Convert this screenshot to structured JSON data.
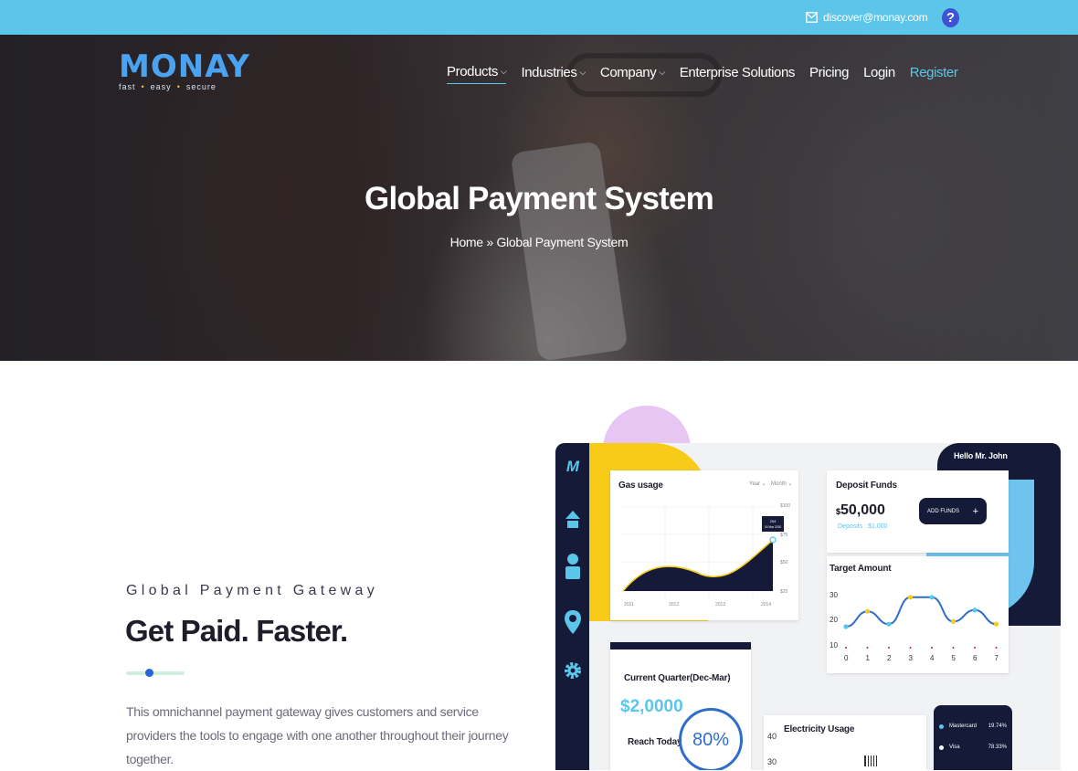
{
  "topbar": {
    "email": "discover@monay.com",
    "help_icon": "help-icon"
  },
  "logo": {
    "name": "Monay",
    "tagline": [
      "fast",
      "easy",
      "secure"
    ]
  },
  "nav": {
    "items": [
      {
        "label": "Products",
        "dropdown": true
      },
      {
        "label": "Industries",
        "dropdown": true
      },
      {
        "label": "Company",
        "dropdown": true
      },
      {
        "label": "Enterprise Solutions"
      },
      {
        "label": "Pricing"
      },
      {
        "label": "Login"
      },
      {
        "label": "Register"
      }
    ]
  },
  "hero": {
    "title": "Global Payment System",
    "breadcrumb_home": "Home",
    "breadcrumb_sep": " » ",
    "breadcrumb_current": "Global Payment System"
  },
  "section": {
    "eyebrow": "Global Payment Gateway",
    "title": "Get Paid. Faster.",
    "description": "This omnichannel payment gateway gives customers and service providers the tools to engage with one another throughout their journey together."
  },
  "dashboard": {
    "greeting": "Hello Mr. John",
    "gas": {
      "title": "Gas usage",
      "toggle_a": "Year",
      "toggle_b": "Month",
      "tooltip_a": "254",
      "tooltip_b": "16 Mar 2020",
      "y_ticks": [
        "$100",
        "$75",
        "$50",
        "$25"
      ],
      "x_ticks": [
        "2011",
        "2012",
        "2013",
        "2014"
      ]
    },
    "deposit": {
      "title": "Deposit Funds",
      "currency": "$",
      "amount": "50,000",
      "deposits": "Deposits : $1,000",
      "button": "ADD FUNDS",
      "button_icon": "+"
    },
    "target": {
      "title": "Target Amount",
      "y_ticks": [
        "30",
        "20",
        "10"
      ],
      "x_ticks": [
        "0",
        "1",
        "2",
        "3",
        "4",
        "5",
        "6",
        "7"
      ]
    },
    "quarter": {
      "title": "Current Quarter(Dec-Mar)",
      "amount": "$2,0000",
      "reach": "Reach Today",
      "percent": "80%"
    },
    "electricity": {
      "title": "Electricity Usage",
      "y_ticks": [
        "40",
        "30"
      ]
    },
    "cards": [
      {
        "name": "Mastercard",
        "value": "19.74%"
      },
      {
        "name": "Visa",
        "value": "78.33%"
      }
    ]
  },
  "chart_data": [
    {
      "type": "area",
      "title": "Gas usage",
      "x": [
        2011,
        2012,
        2013,
        2014
      ],
      "y_axis_labels": [
        "$25",
        "$50",
        "$75",
        "$100"
      ]
    },
    {
      "type": "line",
      "title": "Target Amount",
      "x": [
        0,
        1,
        2,
        3,
        4,
        5,
        6,
        7
      ],
      "ylim": [
        10,
        30
      ],
      "values": [
        17.5,
        23.5,
        18.5,
        29,
        29,
        19.5,
        24,
        18.5
      ]
    }
  ]
}
